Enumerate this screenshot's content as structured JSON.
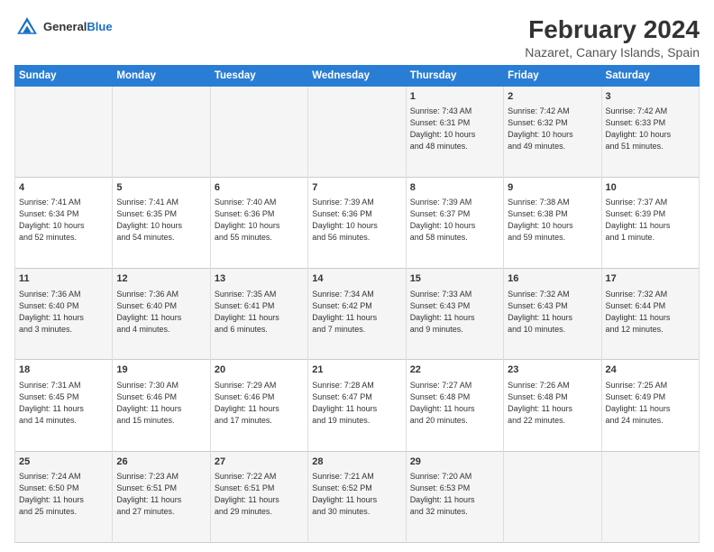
{
  "header": {
    "logo_general": "General",
    "logo_blue": "Blue",
    "title": "February 2024",
    "subtitle": "Nazaret, Canary Islands, Spain"
  },
  "days_of_week": [
    "Sunday",
    "Monday",
    "Tuesday",
    "Wednesday",
    "Thursday",
    "Friday",
    "Saturday"
  ],
  "weeks": [
    [
      {
        "day": "",
        "info": ""
      },
      {
        "day": "",
        "info": ""
      },
      {
        "day": "",
        "info": ""
      },
      {
        "day": "",
        "info": ""
      },
      {
        "day": "1",
        "info": "Sunrise: 7:43 AM\nSunset: 6:31 PM\nDaylight: 10 hours\nand 48 minutes."
      },
      {
        "day": "2",
        "info": "Sunrise: 7:42 AM\nSunset: 6:32 PM\nDaylight: 10 hours\nand 49 minutes."
      },
      {
        "day": "3",
        "info": "Sunrise: 7:42 AM\nSunset: 6:33 PM\nDaylight: 10 hours\nand 51 minutes."
      }
    ],
    [
      {
        "day": "4",
        "info": "Sunrise: 7:41 AM\nSunset: 6:34 PM\nDaylight: 10 hours\nand 52 minutes."
      },
      {
        "day": "5",
        "info": "Sunrise: 7:41 AM\nSunset: 6:35 PM\nDaylight: 10 hours\nand 54 minutes."
      },
      {
        "day": "6",
        "info": "Sunrise: 7:40 AM\nSunset: 6:36 PM\nDaylight: 10 hours\nand 55 minutes."
      },
      {
        "day": "7",
        "info": "Sunrise: 7:39 AM\nSunset: 6:36 PM\nDaylight: 10 hours\nand 56 minutes."
      },
      {
        "day": "8",
        "info": "Sunrise: 7:39 AM\nSunset: 6:37 PM\nDaylight: 10 hours\nand 58 minutes."
      },
      {
        "day": "9",
        "info": "Sunrise: 7:38 AM\nSunset: 6:38 PM\nDaylight: 10 hours\nand 59 minutes."
      },
      {
        "day": "10",
        "info": "Sunrise: 7:37 AM\nSunset: 6:39 PM\nDaylight: 11 hours\nand 1 minute."
      }
    ],
    [
      {
        "day": "11",
        "info": "Sunrise: 7:36 AM\nSunset: 6:40 PM\nDaylight: 11 hours\nand 3 minutes."
      },
      {
        "day": "12",
        "info": "Sunrise: 7:36 AM\nSunset: 6:40 PM\nDaylight: 11 hours\nand 4 minutes."
      },
      {
        "day": "13",
        "info": "Sunrise: 7:35 AM\nSunset: 6:41 PM\nDaylight: 11 hours\nand 6 minutes."
      },
      {
        "day": "14",
        "info": "Sunrise: 7:34 AM\nSunset: 6:42 PM\nDaylight: 11 hours\nand 7 minutes."
      },
      {
        "day": "15",
        "info": "Sunrise: 7:33 AM\nSunset: 6:43 PM\nDaylight: 11 hours\nand 9 minutes."
      },
      {
        "day": "16",
        "info": "Sunrise: 7:32 AM\nSunset: 6:43 PM\nDaylight: 11 hours\nand 10 minutes."
      },
      {
        "day": "17",
        "info": "Sunrise: 7:32 AM\nSunset: 6:44 PM\nDaylight: 11 hours\nand 12 minutes."
      }
    ],
    [
      {
        "day": "18",
        "info": "Sunrise: 7:31 AM\nSunset: 6:45 PM\nDaylight: 11 hours\nand 14 minutes."
      },
      {
        "day": "19",
        "info": "Sunrise: 7:30 AM\nSunset: 6:46 PM\nDaylight: 11 hours\nand 15 minutes."
      },
      {
        "day": "20",
        "info": "Sunrise: 7:29 AM\nSunset: 6:46 PM\nDaylight: 11 hours\nand 17 minutes."
      },
      {
        "day": "21",
        "info": "Sunrise: 7:28 AM\nSunset: 6:47 PM\nDaylight: 11 hours\nand 19 minutes."
      },
      {
        "day": "22",
        "info": "Sunrise: 7:27 AM\nSunset: 6:48 PM\nDaylight: 11 hours\nand 20 minutes."
      },
      {
        "day": "23",
        "info": "Sunrise: 7:26 AM\nSunset: 6:48 PM\nDaylight: 11 hours\nand 22 minutes."
      },
      {
        "day": "24",
        "info": "Sunrise: 7:25 AM\nSunset: 6:49 PM\nDaylight: 11 hours\nand 24 minutes."
      }
    ],
    [
      {
        "day": "25",
        "info": "Sunrise: 7:24 AM\nSunset: 6:50 PM\nDaylight: 11 hours\nand 25 minutes."
      },
      {
        "day": "26",
        "info": "Sunrise: 7:23 AM\nSunset: 6:51 PM\nDaylight: 11 hours\nand 27 minutes."
      },
      {
        "day": "27",
        "info": "Sunrise: 7:22 AM\nSunset: 6:51 PM\nDaylight: 11 hours\nand 29 minutes."
      },
      {
        "day": "28",
        "info": "Sunrise: 7:21 AM\nSunset: 6:52 PM\nDaylight: 11 hours\nand 30 minutes."
      },
      {
        "day": "29",
        "info": "Sunrise: 7:20 AM\nSunset: 6:53 PM\nDaylight: 11 hours\nand 32 minutes."
      },
      {
        "day": "",
        "info": ""
      },
      {
        "day": "",
        "info": ""
      }
    ]
  ]
}
